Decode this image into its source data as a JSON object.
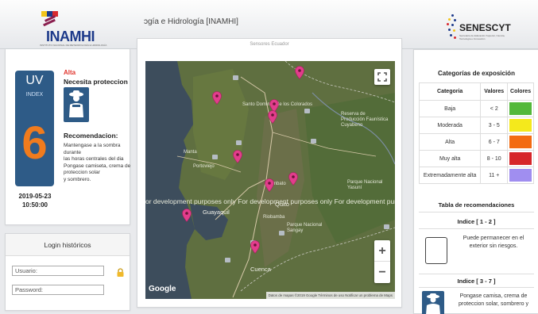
{
  "header": {
    "logo_name": "INAMHI",
    "logo_sub": "INSTITUTO NACIONAL DE METEOROLOGÍA E HIDROLOGÍA",
    "title": "ɔgía e Hidrología [INAMHI]",
    "partner_name": "SENESCYT",
    "partner_sub": "Secretaría de Educación Superior, Ciencia, Tecnología e Innovación"
  },
  "uv": {
    "label": "UV",
    "index_label": "INDEX",
    "value": "6",
    "level": "Alta",
    "need": "Necesita proteccion",
    "rec_title": "Recomendacion:",
    "rec_lines": [
      "Mantengase a la sombra",
      "durante",
      "las horas centrales del dia",
      "Pongase camiseta, crema de",
      "proteccion solar",
      "y sombrero."
    ],
    "date": "2019-05-23",
    "time": "10:50:00"
  },
  "login": {
    "title": "Login históricos",
    "user_placeholder": "Usuario:",
    "pass_placeholder": "Password:"
  },
  "map": {
    "title": "Sensores Ecuador",
    "dev_watermark": "or development purposes only          For development purposes only          For development purposes only          For deve",
    "google": "Google",
    "attribution": "Datos de mapas ©2019 Google   Términos de uso   Notificar un problema de Maps",
    "places": {
      "santo_domingo": "Santo Domingo de los Colorados",
      "manta": "Manta",
      "portoviejo": "Portoviejo",
      "guayaquil": "Guayaquil",
      "ambato": "Ambato",
      "riobamba": "Riobamba",
      "cuenca": "Cuenca",
      "reserva": "Reserva de Producción Faunística Cuyabeno",
      "yasuni": "Parque Nacional Yasuní",
      "sangay": "Parque Nacional Sangay",
      "quito": "Quito"
    }
  },
  "categories": {
    "title": "Categorías de exposición",
    "headers": [
      "Categoria",
      "Valores",
      "Colores"
    ],
    "rows": [
      {
        "name": "Baja",
        "range": "< 2",
        "color": "#53b83a"
      },
      {
        "name": "Moderada",
        "range": "3 - 5",
        "color": "#f4e91c"
      },
      {
        "name": "Alta",
        "range": "6 - 7",
        "color": "#f36b12"
      },
      {
        "name": "Muy alta",
        "range": "8 - 10",
        "color": "#d6262a"
      },
      {
        "name": "Extremadamente alta",
        "range": "11 +",
        "color": "#a08ef0"
      }
    ],
    "rec_table_title": "Tabla de recomendaciones",
    "index_1": "Indice [ 1 - 2 ]",
    "index_1_text": "Puede permanecer en el exterior sin riesgos.",
    "index_2": "Indice [ 3 - 7 ]",
    "index_2_text": "Pongase camisa, crema de proteccion solar, sombrero y"
  },
  "colors": {
    "uv_card": "#2e5b87",
    "uv_value": "#f07b1d",
    "level": "#e0342c",
    "pin": "#e23d8c"
  }
}
